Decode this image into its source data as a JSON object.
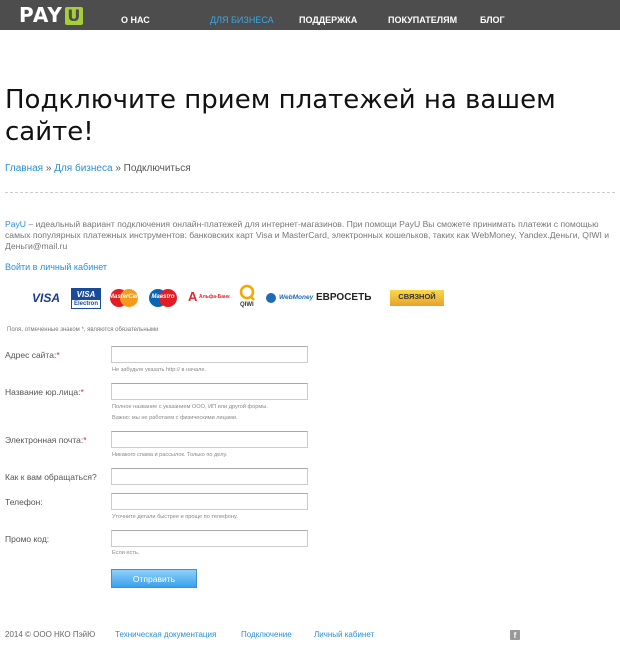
{
  "header": {
    "logo_main": "PAY",
    "logo_accent": "U",
    "nav": [
      "О НАС",
      "ДЛЯ БИЗНЕСА",
      "ПОДДЕРЖКА",
      "ПОКУПАТЕЛЯМ",
      "БЛОГ"
    ],
    "active_nav": "ДЛЯ БИЗНЕСА"
  },
  "page": {
    "title": "Подключите прием платежей на вашем сайте!"
  },
  "breadcrumb": {
    "home": "Главная",
    "sep": "»",
    "section": "Для бизнеса",
    "current": "Подключиться"
  },
  "intro": {
    "brand": "PayU",
    "text": " – идеальный вариант подключения онлайн-платежей для интернет-магазинов. При помощи PayU Вы сможете принимать платежи с помощью самых популярных платежных инструментов: банковских карт Visa и MasterCard, электронных кошельков, таких как WebMoney, Yandex.Деньги, QIWI и Деньги@mail.ru"
  },
  "login_link": "Войти в личный кабинет",
  "payment_logos": {
    "visa": "VISA",
    "visa_electron_top": "VISA",
    "visa_electron_bottom": "Electron",
    "mastercard": "MasterCard",
    "maestro": "Maestro",
    "alfa": "Альфа-Банк",
    "qiwi": "QIWI",
    "webmoney": "WebMoney",
    "euroset": "ЕВРОСЕТЬ",
    "svyaznoy": "СВЯЗНОЙ"
  },
  "form": {
    "required_note": "Поля, отмеченные знаком *, являются обязательными",
    "fields": [
      {
        "label": "Адрес сайта:",
        "required": true,
        "value": "",
        "hint": "Не забудьте указать http:// в начале."
      },
      {
        "label": "Название юр.лица:",
        "required": true,
        "value": "",
        "hint": "Полное название с указанием ООО, ИП или другой формы.",
        "hint2": "Важно: мы не работаем с физическими лицами."
      },
      {
        "label": "Электронная почта:",
        "required": true,
        "value": "",
        "hint": "Никакого спама и рассылок. Только по делу."
      },
      {
        "label": "Как к вам обращаться?",
        "required": false,
        "value": "",
        "hint": ""
      },
      {
        "label": "Телефон:",
        "required": false,
        "value": "",
        "hint": "Уточните детали быстрее и проще по телефону."
      },
      {
        "label": "Промо код:",
        "required": false,
        "value": "",
        "hint": "Если есть."
      }
    ],
    "submit_label": "Отправить"
  },
  "footer": {
    "copyright": "2014 © ООО НКО ПэйЮ",
    "links": [
      "Техническая документация",
      "Подключение",
      "Личный кабинет"
    ],
    "social_icon": "facebook-icon"
  }
}
